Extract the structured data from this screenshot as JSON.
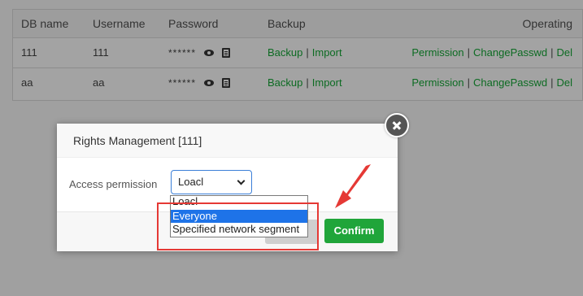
{
  "table": {
    "headers": {
      "db_name": "DB name",
      "username": "Username",
      "password": "Password",
      "backup": "Backup",
      "operating": "Operating"
    },
    "rows": [
      {
        "db_name": "111",
        "username": "111",
        "password": "******",
        "backup": "Backup",
        "import": "Import",
        "permission": "Permission",
        "change_passwd": "ChangePasswd",
        "del": "Del"
      },
      {
        "db_name": "aa",
        "username": "aa",
        "password": "******",
        "backup": "Backup",
        "import": "Import",
        "permission": "Permission",
        "change_passwd": "ChangePasswd",
        "del": "Del"
      }
    ],
    "separator": "|"
  },
  "modal": {
    "title": "Rights Management [111]",
    "access_label": "Access permission",
    "select_value": "Loacl",
    "options": [
      "Loacl",
      "Everyone",
      "Specified network segment"
    ],
    "selected_index": 1,
    "confirm_label": "Confirm"
  },
  "colors": {
    "link": "#0c6b22",
    "confirm": "#20a53a",
    "highlight": "#e53935",
    "option_selected": "#1e73e8"
  }
}
